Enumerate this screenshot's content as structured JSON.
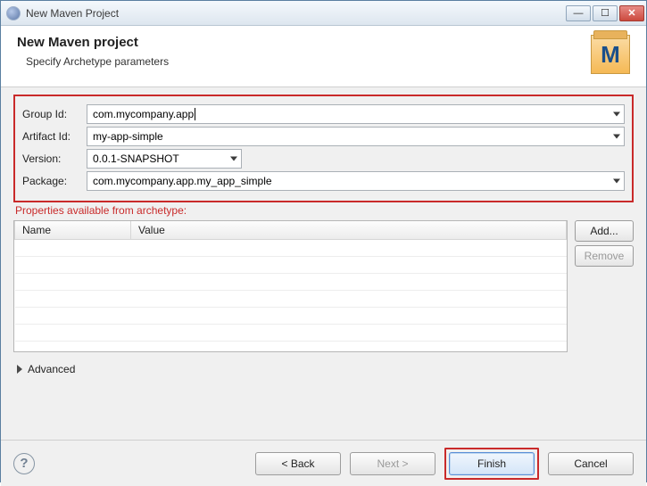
{
  "window": {
    "title": "New Maven Project"
  },
  "banner": {
    "heading": "New Maven project",
    "subheading": "Specify Archetype parameters",
    "icon_letter": "M"
  },
  "form": {
    "groupId": {
      "label": "Group Id:",
      "value": "com.mycompany.app"
    },
    "artifactId": {
      "label": "Artifact Id:",
      "value": "my-app-simple"
    },
    "version": {
      "label": "Version:",
      "value": "0.0.1-SNAPSHOT"
    },
    "package": {
      "label": "Package:",
      "value": "com.mycompany.app.my_app_simple"
    }
  },
  "archetype_props": {
    "section_label": "Properties available from archetype:",
    "columns": {
      "name": "Name",
      "value": "Value"
    },
    "rows": [],
    "buttons": {
      "add": "Add...",
      "remove": "Remove"
    }
  },
  "advanced": {
    "label": "Advanced",
    "expanded": false
  },
  "footer": {
    "back": "< Back",
    "next": "Next >",
    "finish": "Finish",
    "cancel": "Cancel"
  }
}
